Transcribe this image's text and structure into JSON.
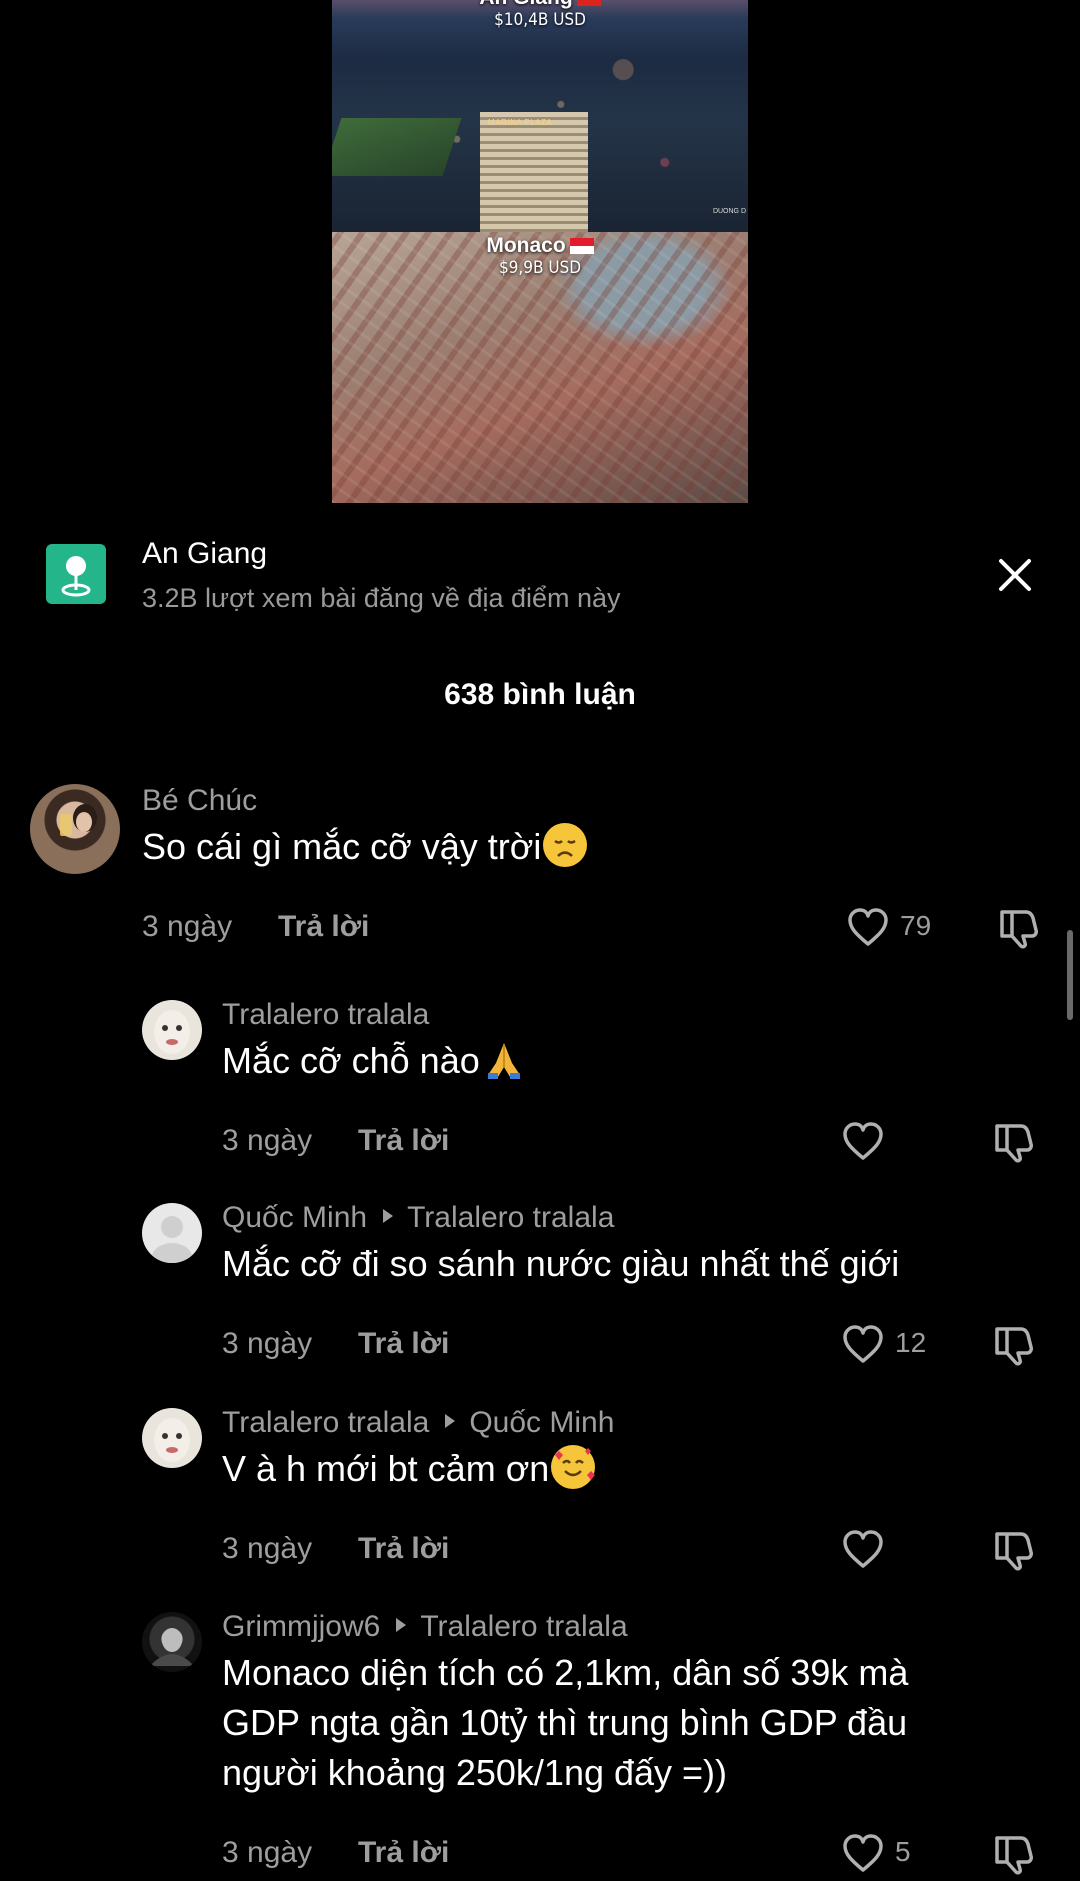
{
  "video": {
    "top_caption_value": "$10,4B USD",
    "top_caption_name": "An Giang",
    "tower_sign": "MARINA PLAZA",
    "watermark": "DUONG D",
    "bottom_caption_name": "Monaco",
    "bottom_caption_value": "$9,9B USD"
  },
  "location": {
    "icon": "location-pin-icon",
    "name": "An Giang",
    "subtitle": "3.2B lượt xem bài đăng về địa điểm này",
    "accent_color": "#25b58b"
  },
  "comments_header": "638 bình luận",
  "comments": [
    {
      "author": "Bé Chúc",
      "reply_to": "",
      "text": "So cái gì mắc cỡ vậy trời",
      "emoji": "disappointed-face",
      "time": "3 ngày",
      "reply_label": "Trả lời",
      "likes": "79"
    },
    {
      "author": "Tralalero tralala",
      "reply_to": "",
      "text": "Mắc cỡ chỗ nào",
      "emoji": "folded-hands",
      "time": "3 ngày",
      "reply_label": "Trả lời",
      "likes": ""
    },
    {
      "author": "Quốc Minh",
      "reply_to": "Tralalero tralala",
      "text": "Mắc cỡ đi so sánh nước giàu nhất thế giới",
      "emoji": "",
      "time": "3 ngày",
      "reply_label": "Trả lời",
      "likes": "12"
    },
    {
      "author": "Tralalero tralala",
      "reply_to": "Quốc Minh",
      "text": "V à h mới bt cảm ơn",
      "emoji": "smiling-face-with-hearts",
      "time": "3 ngày",
      "reply_label": "Trả lời",
      "likes": ""
    },
    {
      "author": "Grimmjjow6",
      "reply_to": "Tralalero tralala",
      "text": "Monaco diện tích có 2,1km, dân số 39k mà\nGDP ngta gần 10tỷ thì trung bình GDP đầu\nngười khoảng 250k/1ng đấy =))",
      "emoji": "",
      "time": "3 ngày",
      "reply_label": "Trả lời",
      "likes": "5"
    }
  ]
}
